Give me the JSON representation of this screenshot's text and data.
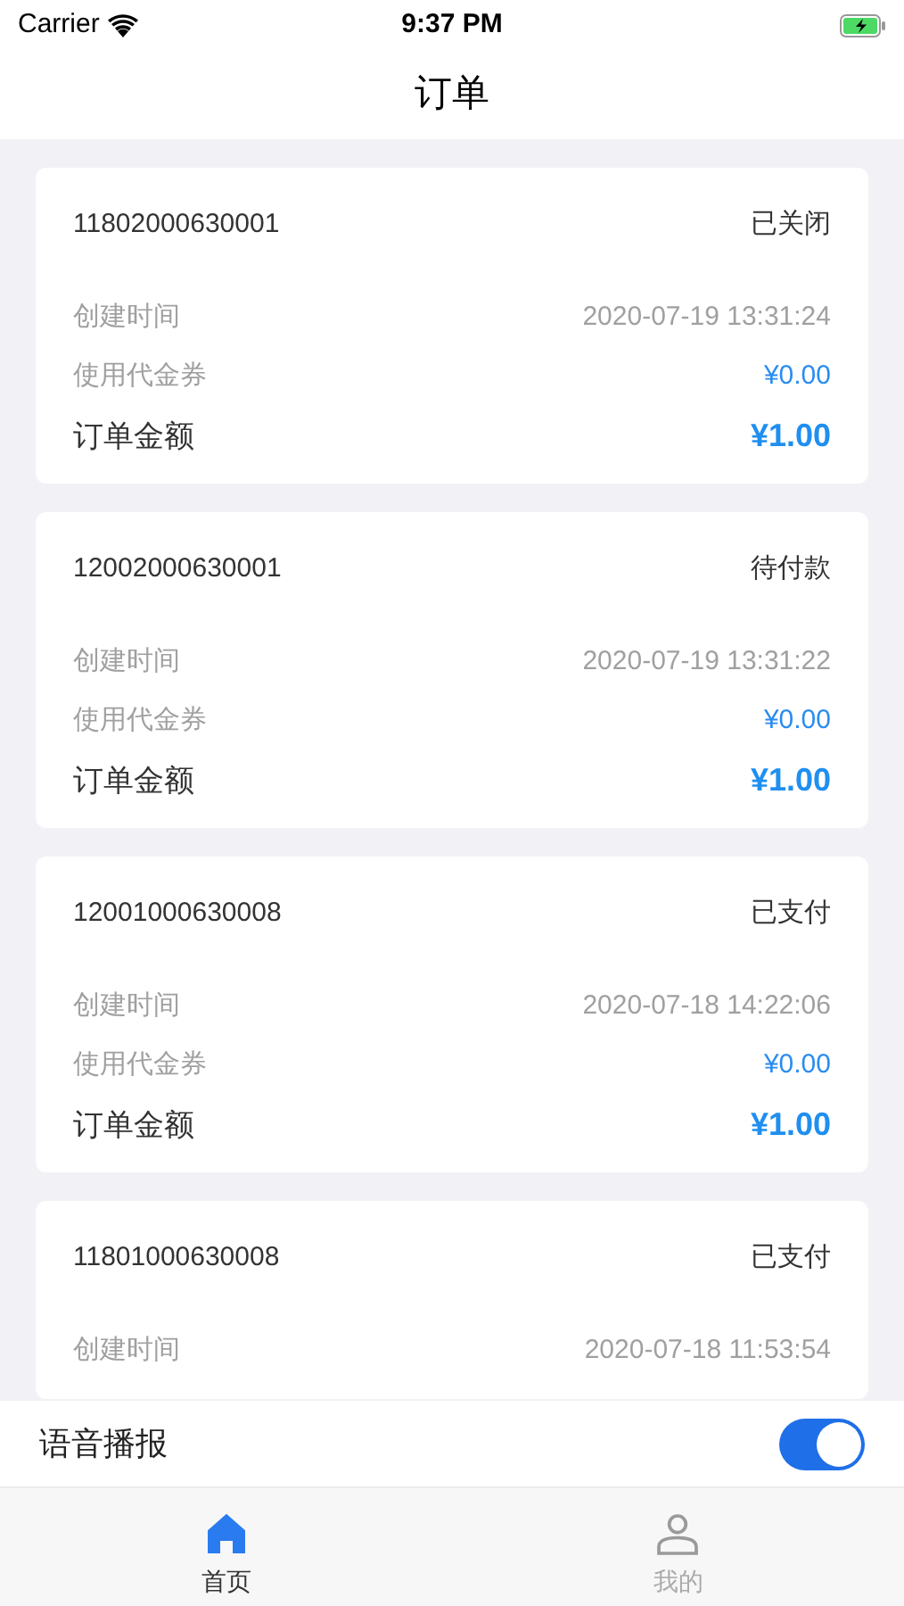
{
  "status_bar": {
    "carrier": "Carrier",
    "time": "9:37 PM"
  },
  "nav": {
    "title": "订单"
  },
  "orders": [
    {
      "order_no": "11802000630001",
      "status": "已关闭",
      "rows": [
        {
          "kind": "time",
          "label": "创建时间",
          "value": "2020-07-19 13:31:24"
        },
        {
          "kind": "voucher",
          "label": "使用代金券",
          "value": "¥0.00"
        },
        {
          "kind": "total",
          "label": "订单金额",
          "value": "¥1.00"
        }
      ]
    },
    {
      "order_no": "12002000630001",
      "status": "待付款",
      "rows": [
        {
          "kind": "time",
          "label": "创建时间",
          "value": "2020-07-19 13:31:22"
        },
        {
          "kind": "voucher",
          "label": "使用代金券",
          "value": "¥0.00"
        },
        {
          "kind": "total",
          "label": "订单金额",
          "value": "¥1.00"
        }
      ]
    },
    {
      "order_no": "12001000630008",
      "status": "已支付",
      "rows": [
        {
          "kind": "time",
          "label": "创建时间",
          "value": "2020-07-18 14:22:06"
        },
        {
          "kind": "voucher",
          "label": "使用代金券",
          "value": "¥0.00"
        },
        {
          "kind": "total",
          "label": "订单金额",
          "value": "¥1.00"
        }
      ]
    },
    {
      "order_no": "11801000630008",
      "status": "已支付",
      "rows": [
        {
          "kind": "time",
          "label": "创建时间",
          "value": "2020-07-18 11:53:54"
        }
      ]
    }
  ],
  "voice": {
    "label": "语音播报",
    "on": true
  },
  "tabs": [
    {
      "kind": "home",
      "label": "首页",
      "selected": true
    },
    {
      "kind": "profile",
      "label": "我的",
      "selected": false
    }
  ]
}
